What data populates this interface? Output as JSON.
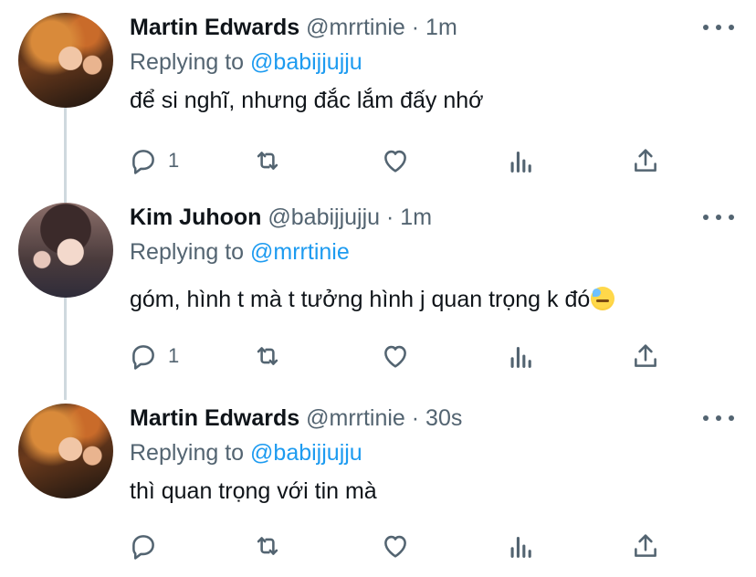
{
  "tweets": [
    {
      "name": "Martin Edwards",
      "handle": "@mrrtinie",
      "time": "· 1m",
      "replying_prefix": "Replying to",
      "replying_to": "@babijjujju",
      "text": "để si nghĩ, nhưng đắc lắm đấy nhớ",
      "reply_count": "1",
      "avatar": "martin-avatar"
    },
    {
      "name": "Kim Juhoon",
      "handle": "@babijjujju",
      "time": "· 1m",
      "replying_prefix": "Replying to",
      "replying_to": "@mrrtinie",
      "text": "góm, hình t mà t tưởng hình j quan trọng k đó",
      "trailing_emoji": "sweat-face-emoji",
      "reply_count": "1",
      "avatar": "kim-avatar"
    },
    {
      "name": "Martin Edwards",
      "handle": "@mrrtinie",
      "time": "· 30s",
      "replying_prefix": "Replying to",
      "replying_to": "@babijjujju",
      "text": "thì quan trọng với tin mà",
      "reply_count": "",
      "avatar": "martin-avatar"
    }
  ],
  "colors": {
    "text": "#0f1419",
    "secondary": "#536471",
    "link": "#1d9bf0",
    "thread_line": "#cfd9de"
  },
  "icons": [
    "reply-icon",
    "retweet-icon",
    "like-icon",
    "analytics-icon",
    "share-icon",
    "more-icon"
  ]
}
